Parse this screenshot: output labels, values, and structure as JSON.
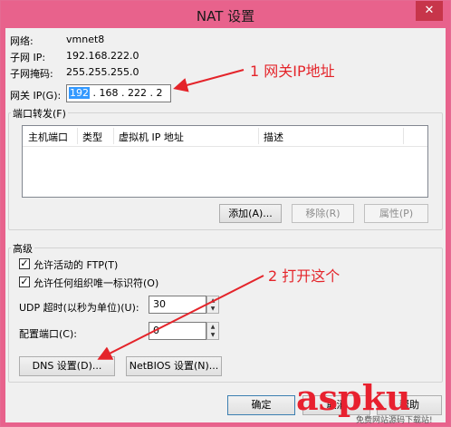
{
  "window": {
    "title": "NAT 设置",
    "close_glyph": "✕"
  },
  "info": {
    "network_label": "网络:",
    "network_value": "vmnet8",
    "subnet_ip_label": "子网 IP:",
    "subnet_ip_value": "192.168.222.0",
    "subnet_mask_label": "子网掩码:",
    "subnet_mask_value": "255.255.255.0"
  },
  "gateway": {
    "label": "网关 IP(G):",
    "octets": [
      "192",
      "168",
      "222",
      "2"
    ],
    "dot": "."
  },
  "port_forward": {
    "title": "端口转发(F)",
    "columns": [
      "主机端口",
      "类型",
      "虚拟机 IP 地址",
      "描述"
    ],
    "add_button": "添加(A)...",
    "remove_button": "移除(R)",
    "properties_button": "属性(P)"
  },
  "advanced": {
    "title": "高级",
    "allow_ftp": "允许活动的 FTP(T)",
    "allow_oui": "允许任何组织唯一标识符(O)",
    "udp_label": "UDP 超时(以秒为单位)(U):",
    "udp_value": "30",
    "config_port_label": "配置端口(C):",
    "config_port_value": "0",
    "dns_button": "DNS 设置(D)...",
    "netbios_button": "NetBIOS 设置(N)..."
  },
  "footer": {
    "ok_button": "确定",
    "cancel_button": "取消",
    "help_button": "帮助"
  },
  "annotations": {
    "step1": "1 网关IP地址",
    "step2": "2 打开这个",
    "arrow_color": "#e4242a"
  },
  "watermark": {
    "brand": "aspku",
    "subtitle": "免费网站源码下载站!"
  }
}
